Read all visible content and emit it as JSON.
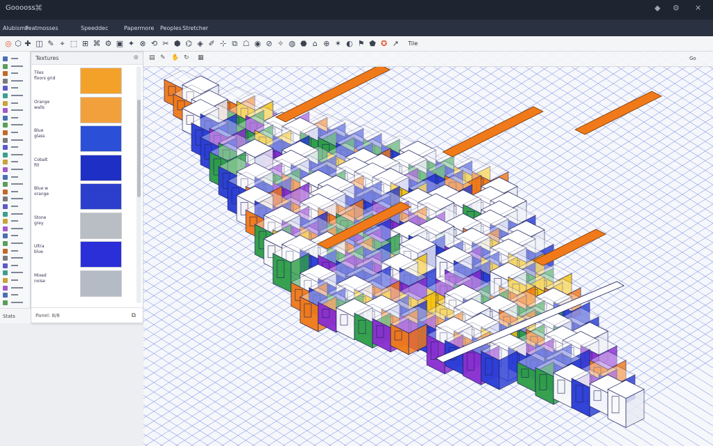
{
  "app": {
    "title": "Gooooss",
    "menu_glyph": "⌘",
    "window_controls": [
      "◆",
      "⚙",
      "✕"
    ]
  },
  "menubar": {
    "items": [
      "Alubisms",
      "Peatmosses",
      "Speeddec",
      "Papermore",
      "Peoples",
      "Stretcher"
    ]
  },
  "toolbar": {
    "label": "Tile"
  },
  "panel": {
    "title": "Textures",
    "pin_icon": "pin-icon",
    "footer_label": "Panel: 8/8",
    "footer_icon": "layers-icon",
    "thumbs": [
      {
        "caption": "Tiles \nfloors grid",
        "color": "#f4a12a"
      },
      {
        "caption": "Orange\nwalls",
        "color": "#f2a03c"
      },
      {
        "caption": "Blue\nglass",
        "color": "#2b4fd6"
      },
      {
        "caption": "Cobalt\nfill",
        "color": "#1d2fc4"
      },
      {
        "caption": "Blue w\norange",
        "color": "#2c3fcc"
      },
      {
        "caption": "Stone\ngrey",
        "color": "#b9bdc4"
      },
      {
        "caption": "Ultra\nblue",
        "color": "#2a2fd8"
      },
      {
        "caption": "Mixed\nnoise",
        "color": "#b5bbc4"
      }
    ]
  },
  "bottom_left": {
    "label": "Stats"
  },
  "viewport": {
    "zoom_label": "Go",
    "colors": {
      "blue": "#2b3ed6",
      "purple": "#8a2fd0",
      "orange": "#f07a1a",
      "green": "#2f9e48",
      "yellow": "#f6c412",
      "white": "#fbfbfd",
      "grid": "#3d5ad8"
    }
  }
}
